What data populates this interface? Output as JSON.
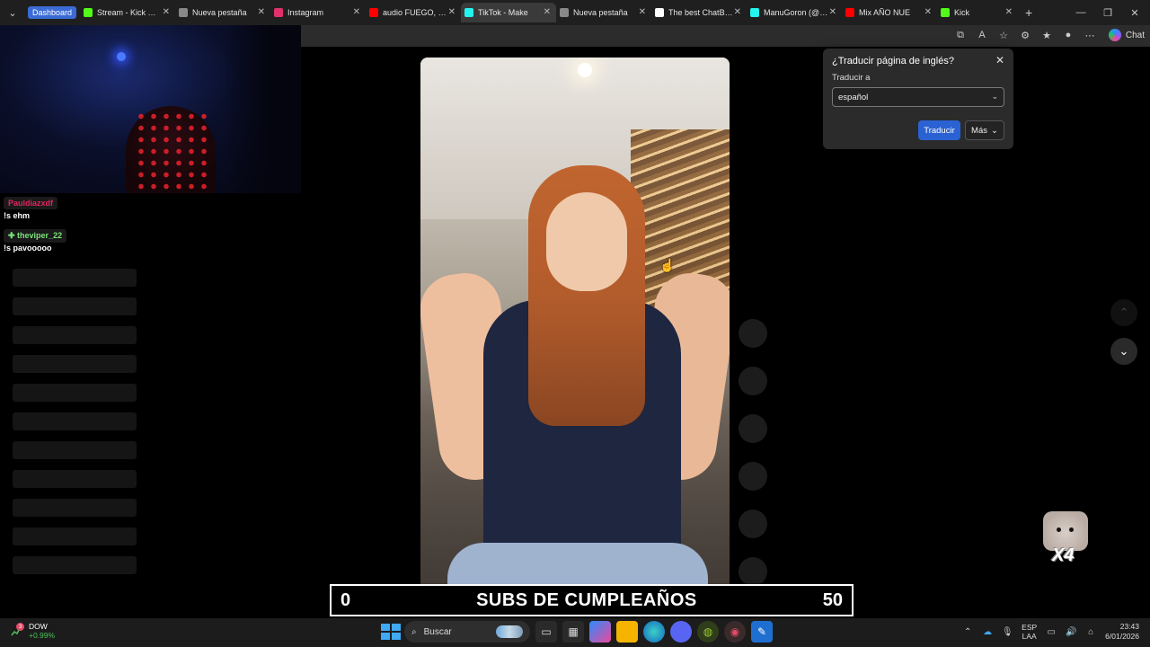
{
  "browser": {
    "tabs": [
      {
        "label": "Dashboard",
        "pill": true,
        "color": "#3b6bd6"
      },
      {
        "label": "Stream - Kick Dash",
        "color": "#53fc18"
      },
      {
        "label": "Nueva pestaña",
        "color": "#888888"
      },
      {
        "label": "Instagram",
        "color": "#e1306c"
      },
      {
        "label": "audio FUEGO, FUE",
        "color": "#ff0000"
      },
      {
        "label": "TikTok - Make",
        "color": "#25f4ee",
        "active": true
      },
      {
        "label": "Nueva pestaña",
        "color": "#888888"
      },
      {
        "label": "The best ChatBot a",
        "color": "#ffffff"
      },
      {
        "label": "ManuGoron (@ma",
        "color": "#25f4ee"
      },
      {
        "label": "Mix AÑO NUE",
        "color": "#ff0000"
      },
      {
        "label": "Kick",
        "color": "#53fc18"
      }
    ],
    "copilot_label": "Chat"
  },
  "chat": {
    "messages": [
      {
        "user": "Pauldiazxdf",
        "text": "!s ehm",
        "color": "#e0245e"
      },
      {
        "user": "theviper_22",
        "text": "!s pavooooo",
        "color": "#7ae37a"
      }
    ]
  },
  "translate_popup": {
    "title": "¿Traducir página de inglés?",
    "label": "Traducir a",
    "language": "español",
    "translate_button": "Traducir",
    "more_button": "Más"
  },
  "overlay": {
    "subs_left": "0",
    "subs_title": "SUBS DE CUMPLEAÑOS",
    "subs_right": "50",
    "sticker_multiplier": "X4"
  },
  "taskbar": {
    "stock_name": "DOW",
    "stock_change": "+0.99%",
    "notif_count": "3",
    "search_placeholder": "Buscar",
    "lang_top": "ESP",
    "lang_bottom": "LAA",
    "time": "23:43",
    "date": "6/01/2026"
  }
}
